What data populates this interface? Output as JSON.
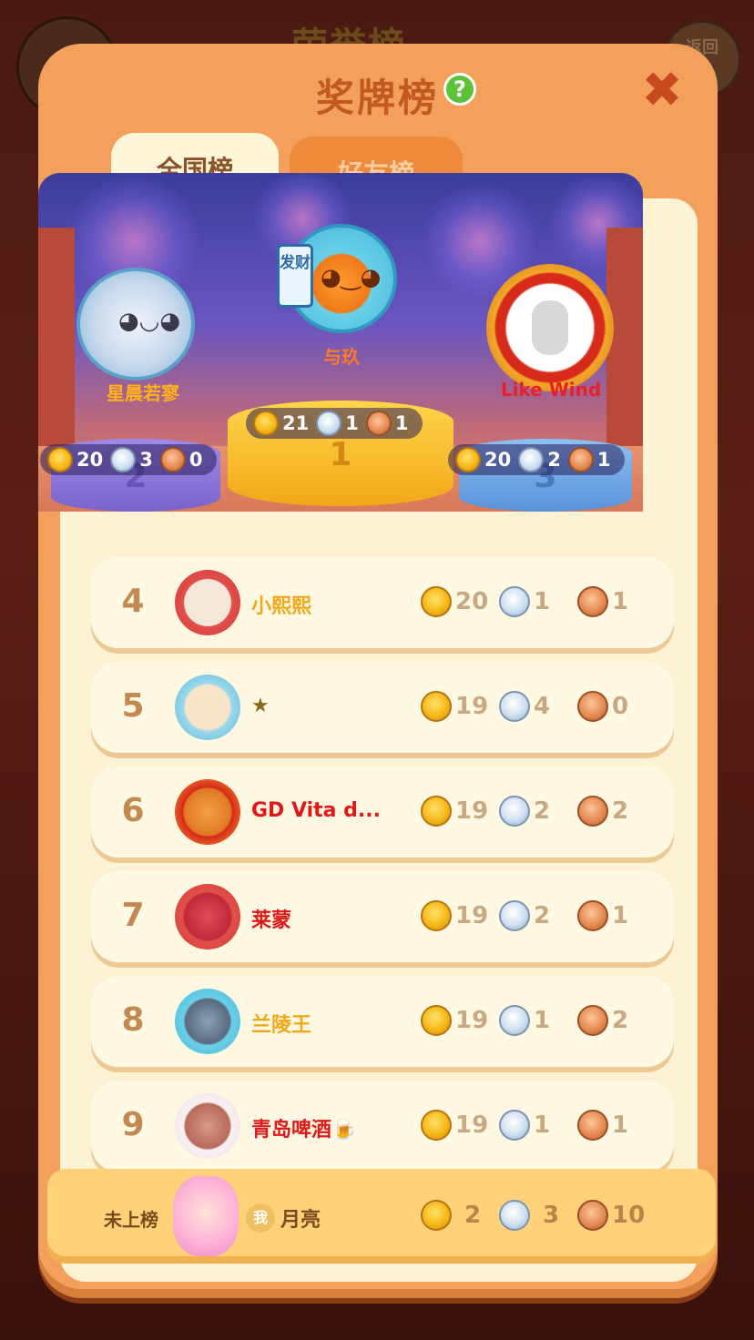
{
  "background": {
    "title": "荣誉榜",
    "back_label": "返回"
  },
  "dialog": {
    "title": "奖牌榜",
    "help_icon": "?",
    "close_icon": "✖",
    "tabs": [
      {
        "label": "全国榜",
        "active": true
      },
      {
        "label": "好友榜",
        "active": false
      }
    ]
  },
  "podium": [
    {
      "place": "1",
      "name": "与玖",
      "name_color": "#ff7a28",
      "tag": "发财",
      "gold": "21",
      "silver": "1",
      "bronze": "1"
    },
    {
      "place": "2",
      "name": "星晨若寥",
      "name_color": "#ffb01a",
      "gold": "20",
      "silver": "3",
      "bronze": "0"
    },
    {
      "place": "3",
      "name": "Like Wind",
      "name_color": "#e8202a",
      "gold": "20",
      "silver": "2",
      "bronze": "1"
    }
  ],
  "rows": [
    {
      "rank": "4",
      "name": "小熙熙",
      "name_color": "#f0a818",
      "gold": "20",
      "silver": "1",
      "bronze": "1"
    },
    {
      "rank": "5",
      "name": "★",
      "name_color": "#8a6a1a",
      "gold": "19",
      "silver": "4",
      "bronze": "0"
    },
    {
      "rank": "6",
      "name": "GD Vita d...",
      "name_color": "#e01818",
      "gold": "19",
      "silver": "2",
      "bronze": "2"
    },
    {
      "rank": "7",
      "name": "莱蒙",
      "name_color": "#e01818",
      "gold": "19",
      "silver": "2",
      "bronze": "1"
    },
    {
      "rank": "8",
      "name": "兰陵王",
      "name_color": "#f0a818",
      "gold": "19",
      "silver": "1",
      "bronze": "2"
    },
    {
      "rank": "9",
      "name": "青岛啤酒🍺",
      "name_color": "#e01818",
      "gold": "19",
      "silver": "1",
      "bronze": "1"
    }
  ],
  "me": {
    "status": "未上榜",
    "badge": "我",
    "name": "月亮",
    "gold": "2",
    "silver": "3",
    "bronze": "10"
  },
  "colors": {
    "dialog_bg": "#f2a05c",
    "panel_bg": "#fdf2d4",
    "row_bg": "#fff8e2",
    "accent": "#c25a20"
  }
}
